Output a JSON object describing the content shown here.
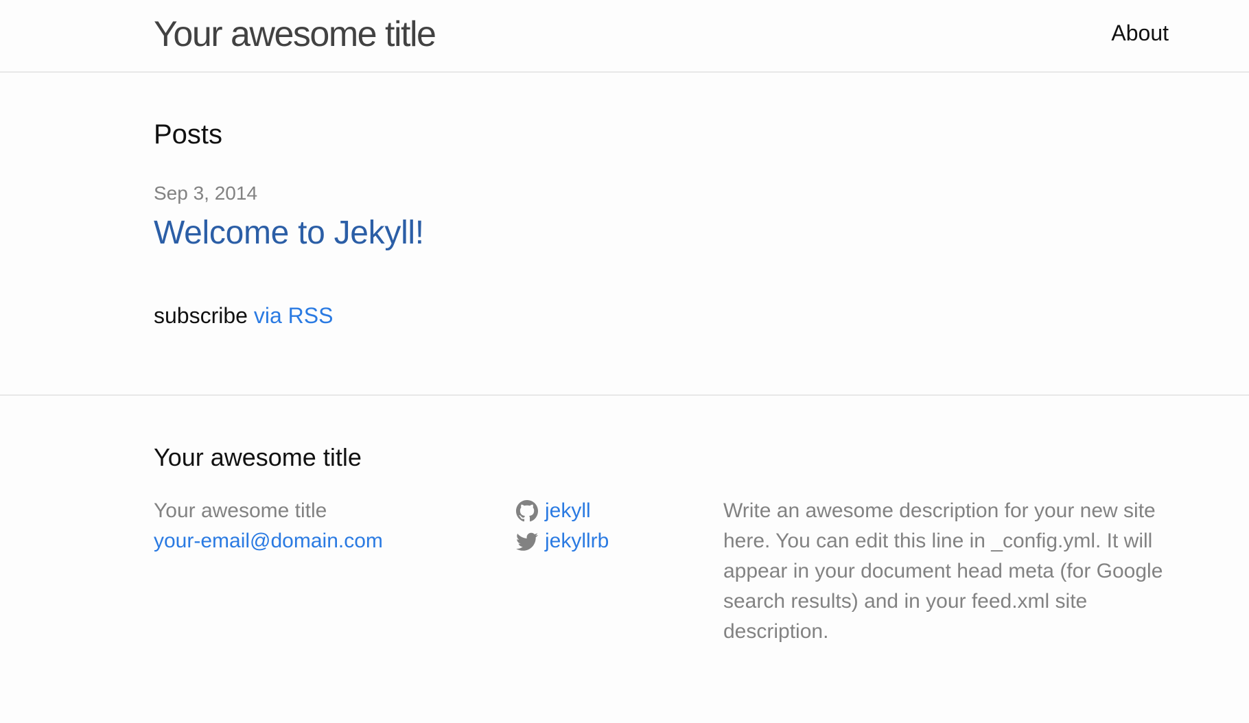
{
  "header": {
    "site_title": "Your awesome title",
    "nav": {
      "about_label": "About"
    }
  },
  "main": {
    "heading": "Posts",
    "posts": [
      {
        "date": "Sep 3, 2014",
        "title": "Welcome to Jekyll!"
      }
    ],
    "rss": {
      "prefix": "subscribe",
      "link_label": "via RSS"
    }
  },
  "footer": {
    "heading": "Your awesome title",
    "contact": {
      "name": "Your awesome title",
      "email": "your-email@domain.com"
    },
    "social": {
      "github": {
        "icon": "github-icon",
        "username": "jekyll"
      },
      "twitter": {
        "icon": "twitter-icon",
        "username": "jekyllrb"
      }
    },
    "description": "Write an awesome description for your new site here. You can edit this line in _config.yml. It will appear in your document head meta (for Google search results) and in your feed.xml site description."
  },
  "colors": {
    "link": "#2a7ae2",
    "post_title": "#2b5ea6",
    "muted_text": "#828282",
    "border": "#e8e8e8",
    "background": "#fdfdfd"
  }
}
